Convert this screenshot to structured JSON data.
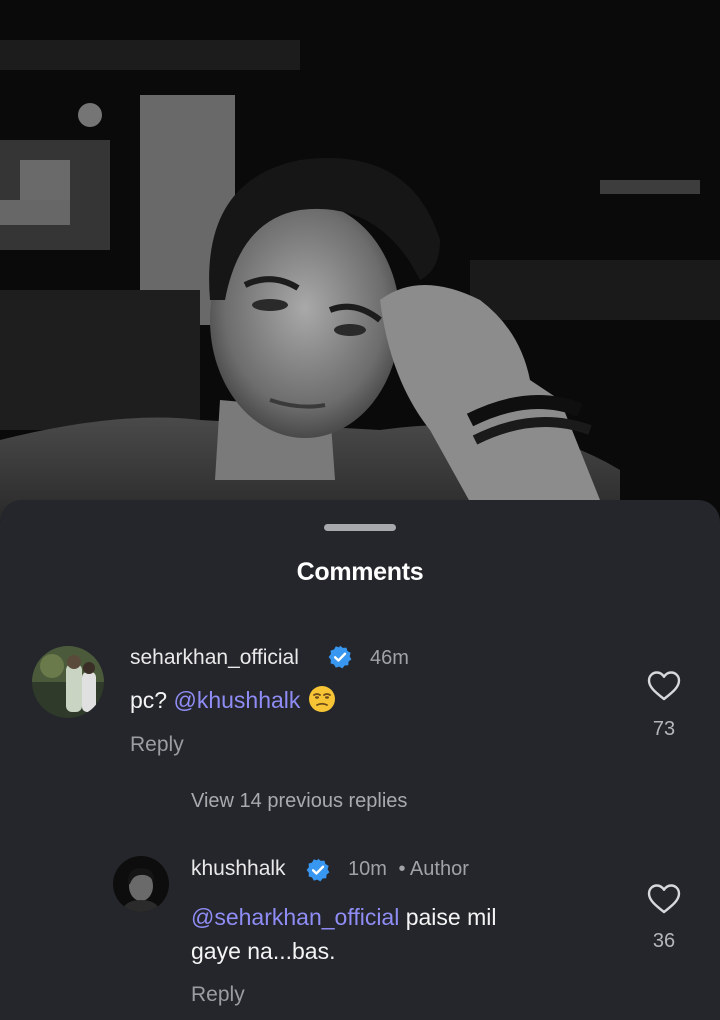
{
  "sheet": {
    "title": "Comments"
  },
  "comments": [
    {
      "username": "seharkhan_official",
      "verified": true,
      "time": "46m",
      "text_plain_prefix": "pc? ",
      "mention": "@khushhalk",
      "text_rest": "",
      "emoji": "unamused-face",
      "reply_label": "Reply",
      "like_count": "73"
    }
  ],
  "view_replies_label": "View 14 previous replies",
  "replies": [
    {
      "username": "khushhalk",
      "verified": true,
      "time": "10m",
      "author_tag": "• Author",
      "mention": "@seharkhan_official",
      "text_line1_rest": " paise mil",
      "text_line2": "gaye na...bas.",
      "reply_label": "Reply",
      "like_count": "36"
    }
  ],
  "colors": {
    "sheet_bg": "#24262b",
    "mention": "#8f8df5",
    "verified_badge": "#3897f0"
  }
}
